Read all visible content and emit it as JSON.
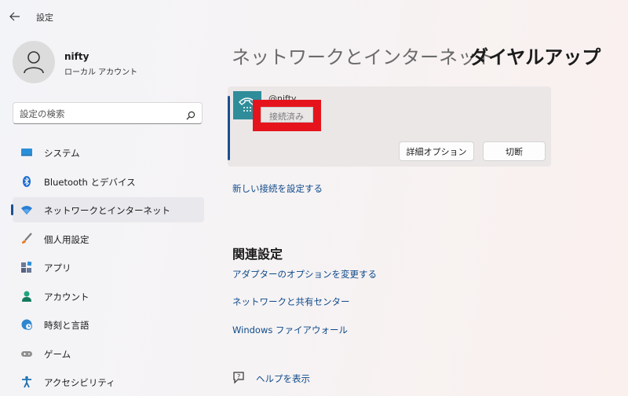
{
  "app": {
    "title": "設定"
  },
  "user": {
    "name": "nifty",
    "account_type": "ローカル アカウント"
  },
  "search": {
    "placeholder": "設定の検索"
  },
  "sidebar": {
    "items": [
      {
        "label": "システム",
        "icon": "monitor-icon"
      },
      {
        "label": "Bluetooth とデバイス",
        "icon": "bluetooth-icon"
      },
      {
        "label": "ネットワークとインターネット",
        "icon": "wifi-icon",
        "active": true
      },
      {
        "label": "個人用設定",
        "icon": "brush-icon"
      },
      {
        "label": "アプリ",
        "icon": "apps-icon"
      },
      {
        "label": "アカウント",
        "icon": "account-icon"
      },
      {
        "label": "時刻と言語",
        "icon": "globe-clock-icon"
      },
      {
        "label": "ゲーム",
        "icon": "gamepad-icon"
      },
      {
        "label": "アクセシビリティ",
        "icon": "accessibility-icon"
      }
    ]
  },
  "breadcrumb": {
    "parent": "ネットワークとインターネット",
    "separator": "›",
    "current": "ダイヤルアップ"
  },
  "connection": {
    "name": "@nifty",
    "status": "接続済み",
    "advanced_button": "詳細オプション",
    "disconnect_button": "切断"
  },
  "new_connection_link": "新しい接続を設定する",
  "related": {
    "title": "関連設定",
    "links": [
      "アダプターのオプションを変更する",
      "ネットワークと共有センター",
      "Windows ファイアウォール"
    ]
  },
  "help": {
    "label": "ヘルプを表示"
  },
  "colors": {
    "accent": "#1b4f92",
    "highlight_box": "#e5141c",
    "link": "#0e4a8a"
  }
}
